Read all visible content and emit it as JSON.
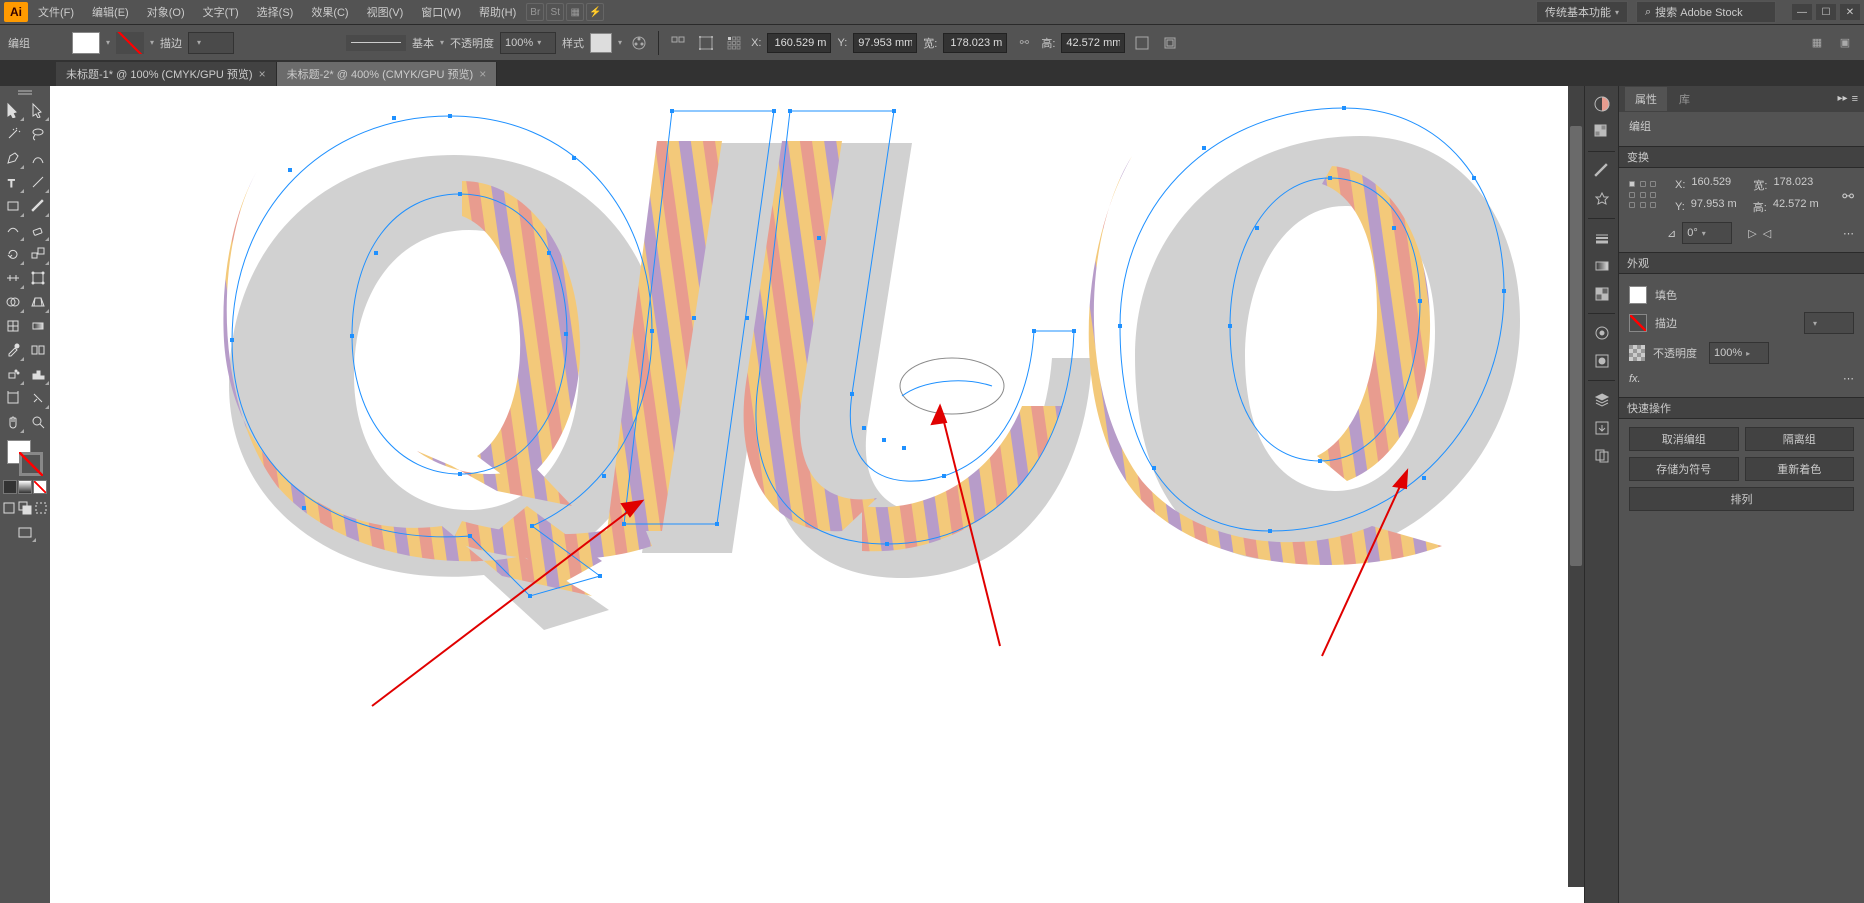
{
  "menubar": {
    "logo": "Ai",
    "items": [
      "文件(F)",
      "编辑(E)",
      "对象(O)",
      "文字(T)",
      "选择(S)",
      "效果(C)",
      "视图(V)",
      "窗口(W)",
      "帮助(H)"
    ],
    "workspace": "传统基本功能",
    "search_placeholder": "搜索 Adobe Stock"
  },
  "controlbar": {
    "selection_label": "编组",
    "stroke_label": "描边",
    "stroke_weight": "",
    "brush_label": "基本",
    "opacity_label": "不透明度",
    "opacity_value": "100%",
    "style_label": "样式",
    "x_label": "X:",
    "x_value": "160.529 m",
    "y_label": "Y:",
    "y_value": "97.953 mm",
    "w_label": "宽:",
    "w_value": "178.023 m",
    "h_label": "高:",
    "h_value": "42.572 mm"
  },
  "tabs": [
    {
      "label": "未标题-1* @ 100% (CMYK/GPU 预览)",
      "active": false
    },
    {
      "label": "未标题-2* @ 400% (CMYK/GPU 预览)",
      "active": true
    }
  ],
  "properties": {
    "tab_props": "属性",
    "tab_lib": "库",
    "selection": "编组",
    "transform_hdr": "变换",
    "x_label": "X:",
    "x_value": "160.529",
    "y_label": "Y:",
    "y_value": "97.953 m",
    "w_label": "宽:",
    "w_value": "178.023",
    "h_label": "高:",
    "h_value": "42.572 m",
    "rot_label": "⊿",
    "rot_value": "0°",
    "flip_label": "▷◁",
    "appearance_hdr": "外观",
    "fill_label": "填色",
    "stroke_label": "描边",
    "stroke_size": "",
    "opacity_label": "不透明度",
    "opacity_value": "100%",
    "fx_label": "fx.",
    "quick_hdr": "快速操作",
    "btn_ungroup": "取消编组",
    "btn_isolate": "隔离组",
    "btn_saveassymbol": "存储为符号",
    "btn_recolor": "重新着色",
    "btn_arrange": "排列"
  }
}
